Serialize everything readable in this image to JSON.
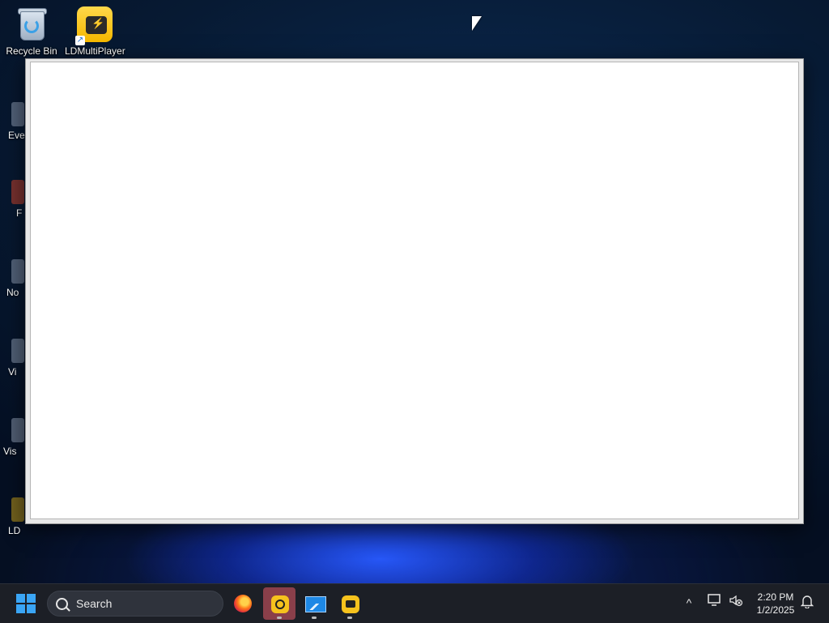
{
  "desktop": {
    "icons": [
      {
        "label": "Recycle Bin",
        "icon": "recycle-bin-icon"
      },
      {
        "label": "LDMultiPlayer",
        "icon": "ldmultiplayer-icon"
      }
    ],
    "partial_icons": [
      {
        "label": "Eve"
      },
      {
        "label": "F"
      },
      {
        "label": "No"
      },
      {
        "label": "Vi"
      },
      {
        "label": "Vis"
      },
      {
        "label": "LD"
      }
    ]
  },
  "window": {
    "title": ""
  },
  "taskbar": {
    "search_label": "Search",
    "apps": [
      {
        "name": "firefox",
        "icon": "firefox-icon"
      },
      {
        "name": "ldplayer",
        "icon": "ldplayer-icon",
        "active": true
      },
      {
        "name": "chart-app",
        "icon": "chart-app-icon"
      },
      {
        "name": "ldmultiplayer",
        "icon": "ldmultiplayer-icon"
      }
    ],
    "tray": {
      "show_hidden_icon": "^",
      "time": "2:20 PM",
      "date": "1/2/2025"
    }
  },
  "colors": {
    "taskbar_bg": "#1c1f26",
    "active_app": "#8a3f4a",
    "windows_blue": "#3aa5f5",
    "ld_yellow": "#f6c21d"
  }
}
